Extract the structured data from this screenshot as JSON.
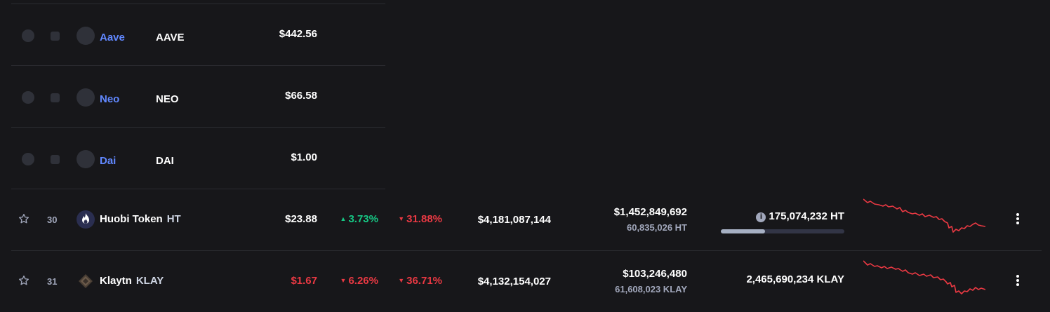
{
  "skeleton_rows": [
    {
      "name": "Aave",
      "symbol": "AAVE",
      "price": "$442.56"
    },
    {
      "name": "Neo",
      "symbol": "NEO",
      "price": "$66.58"
    },
    {
      "name": "Dai",
      "symbol": "DAI",
      "price": "$1.00"
    }
  ],
  "rows": [
    {
      "rank": "30",
      "name": "Huobi Token",
      "symbol": "HT",
      "price": "$23.88",
      "price_color": "#ffffff",
      "change_24h": "3.73%",
      "change_24h_dir": "up",
      "change_7d": "31.88%",
      "change_7d_dir": "down",
      "market_cap": "$4,181,087,144",
      "volume_usd": "$1,452,849,692",
      "volume_coin": "60,835,026 HT",
      "circulating_supply": "175,074,232 HT",
      "supply_fraction": 0.36,
      "icon": "huobi-flame-icon"
    },
    {
      "rank": "31",
      "name": "Klaytn",
      "symbol": "KLAY",
      "price": "$1.67",
      "price_color": "#ea3943",
      "change_24h": "6.26%",
      "change_24h_dir": "down",
      "change_7d": "36.71%",
      "change_7d_dir": "down",
      "market_cap": "$4,132,154,027",
      "volume_usd": "$103,246,480",
      "volume_coin": "61,608,023 KLAY",
      "circulating_supply": "2,465,690,234 KLAY",
      "icon": "klaytn-logo-icon"
    }
  ],
  "colors": {
    "background": "#17171a",
    "link": "#6188ff",
    "up": "#16c784",
    "down": "#ea3943",
    "sparkline": "#ea3943"
  }
}
